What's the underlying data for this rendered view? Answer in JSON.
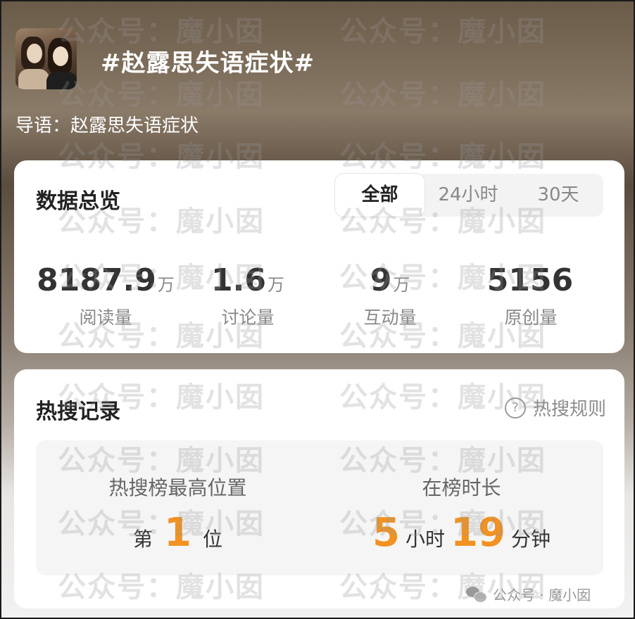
{
  "header": {
    "topic_title": "#赵露思失语症状#",
    "lead_label": "导语：",
    "lead_text": "赵露思失语症状"
  },
  "overview": {
    "title": "数据总览",
    "tabs": [
      {
        "label": "全部",
        "active": true
      },
      {
        "label": "24小时",
        "active": false
      },
      {
        "label": "30天",
        "active": false
      }
    ],
    "stats": [
      {
        "value": "8187.9",
        "unit": "万",
        "label": "阅读量"
      },
      {
        "value": "1.6",
        "unit": "万",
        "label": "讨论量"
      },
      {
        "value": "9",
        "unit": "万",
        "label": "互动量"
      },
      {
        "value": "5156",
        "unit": "",
        "label": "原创量"
      }
    ]
  },
  "hot_search": {
    "title": "热搜记录",
    "rules_label": "热搜规则",
    "rules_icon": "question-circle-icon",
    "highest_rank": {
      "label": "热搜榜最高位置",
      "prefix": "第",
      "value": "1",
      "suffix": "位"
    },
    "duration": {
      "label": "在榜时长",
      "hours": "5",
      "hours_unit": "小时",
      "minutes": "19",
      "minutes_unit": "分钟"
    }
  },
  "footer": {
    "text": "公众号 · 魔小囡",
    "icon": "wechat-icon"
  },
  "watermark": {
    "text": "公众号：魔小囡"
  },
  "colors": {
    "accent_orange": "#f29222",
    "card_bg": "#ffffff",
    "muted_text": "#888888"
  }
}
